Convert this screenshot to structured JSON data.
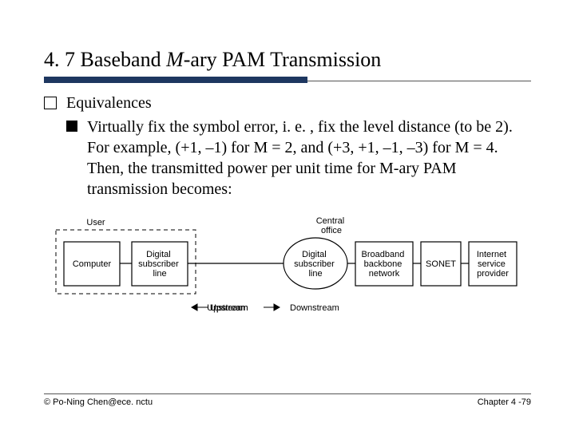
{
  "title_prefix": "4. 7 Baseband ",
  "title_italic": "M",
  "title_suffix": "-ary PAM Transmission",
  "lvl1_text": "Equivalences",
  "lvl2_text": "Virtually fix the symbol error, i. e. , fix the level distance (to be 2). For example, (+1, –1) for M = 2, and (+3, +1, –1, –3) for M = 4. Then, the transmitted power per unit time for M-ary PAM transmission becomes:",
  "diagram": {
    "user_label": "User",
    "computer": "Computer",
    "dsl1": "Digital\nsubscriber\nline",
    "central_label": "Central\noffice",
    "dsl2": "Digital\nsubscriber\nline",
    "broadband": "Broadband\nbackbone\nnetwork",
    "sonet": "SONET",
    "isp": "Internet\nservice\nprovider",
    "upstream": "Upstream",
    "downstream": "Downstream"
  },
  "footer_left": "© Po-Ning Chen@ece. nctu",
  "footer_right": "Chapter 4 -79"
}
